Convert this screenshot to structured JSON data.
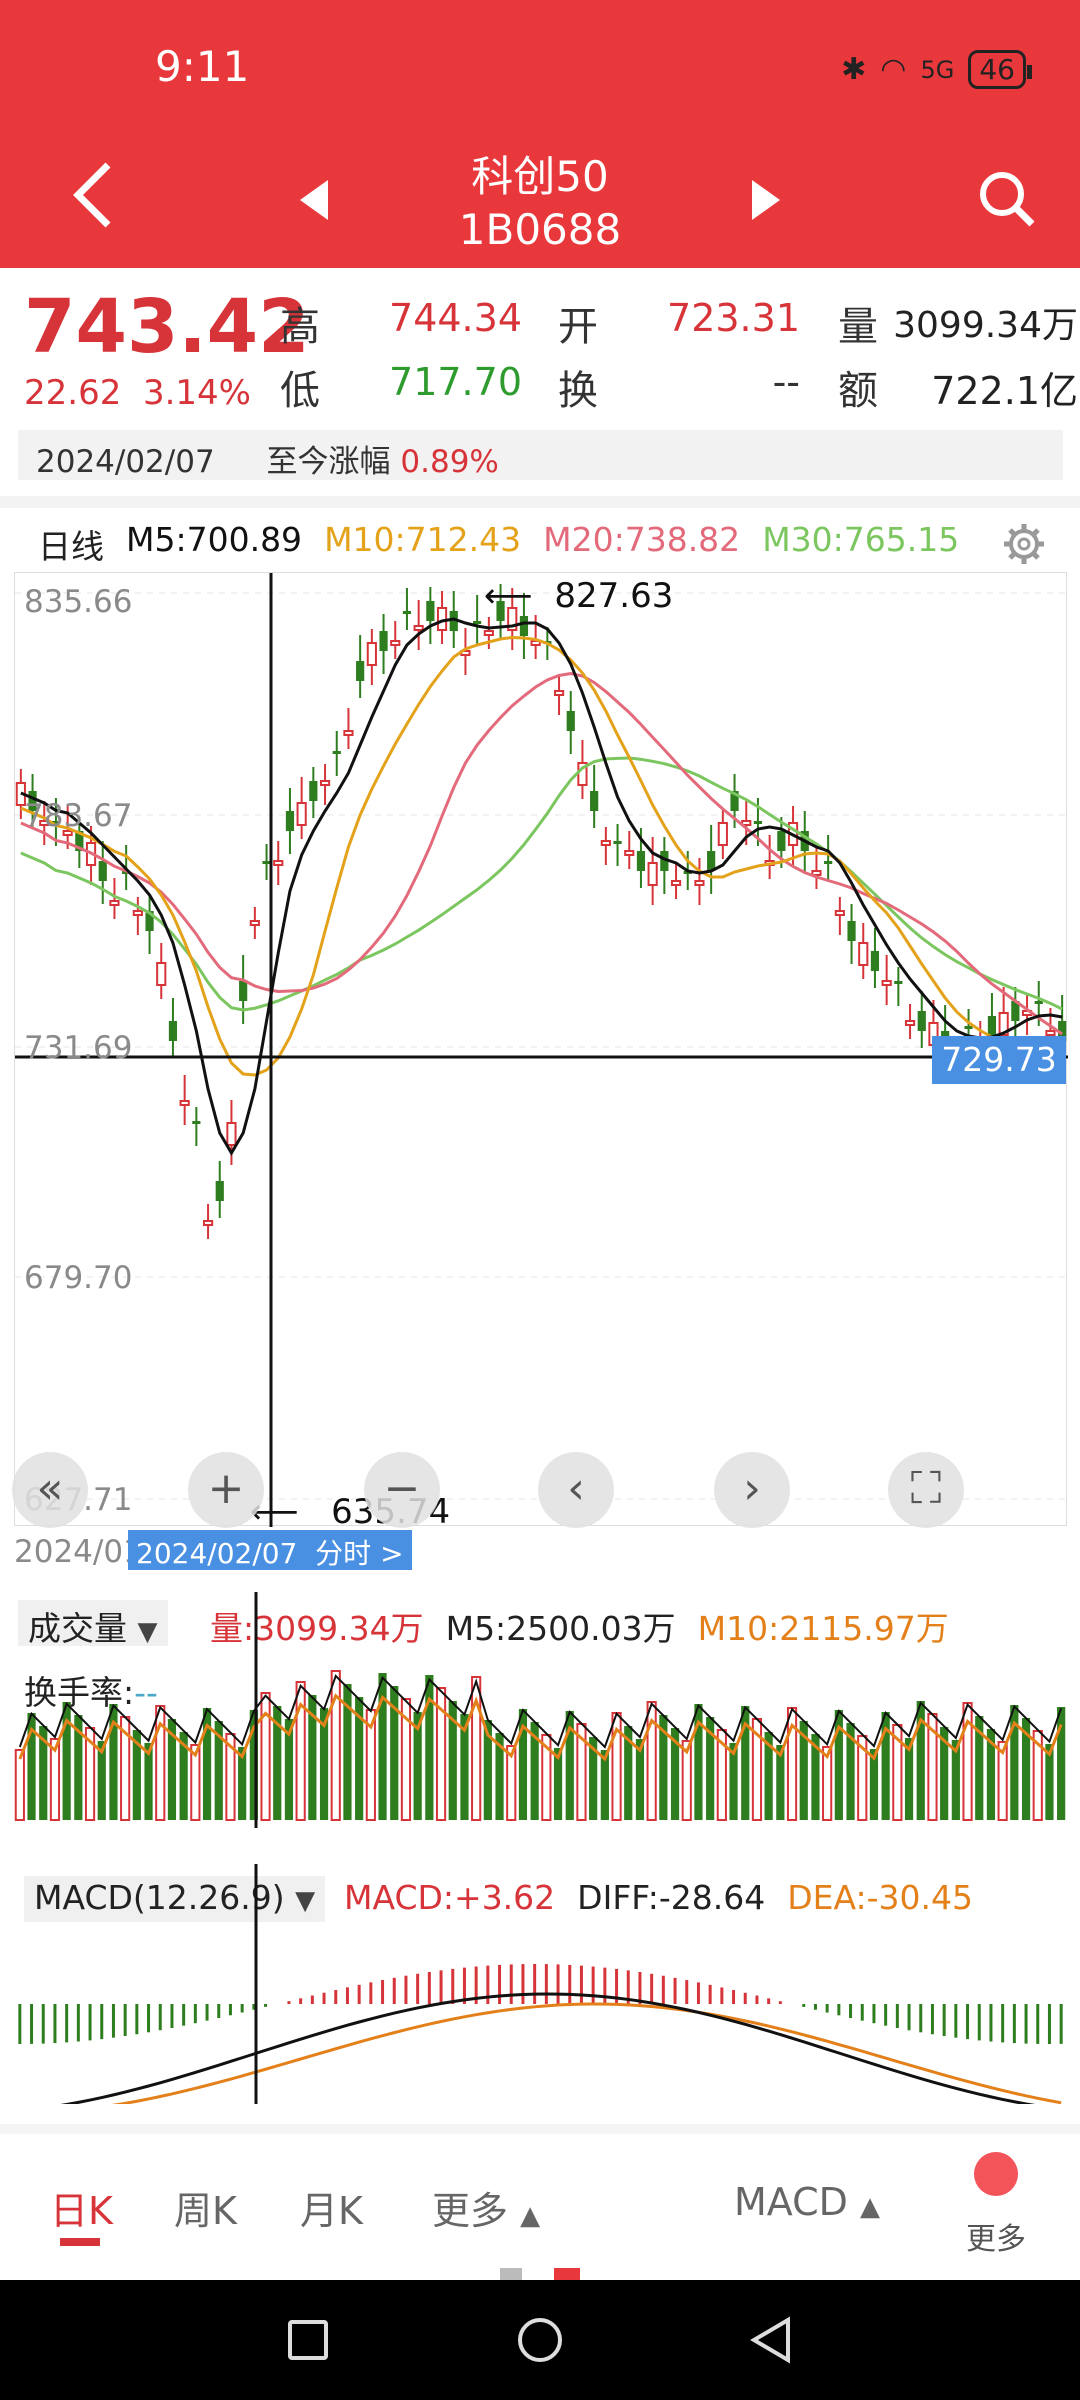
{
  "status_bar": {
    "time": "9:11",
    "battery": "46",
    "signal": "5G"
  },
  "header": {
    "title": "科创50",
    "code": "1B0688"
  },
  "quote": {
    "price": "743.42",
    "change": "22.62",
    "change_pct": "3.14%",
    "high_label": "高",
    "high": "744.34",
    "low_label": "低",
    "low": "717.70",
    "open_label": "开",
    "open": "723.31",
    "turnover_label": "换",
    "turnover": "--",
    "volume_label": "量",
    "volume": "3099.34万",
    "amount_label": "额",
    "amount": "722.1亿",
    "date": "2024/02/07",
    "since_label": "至今涨幅",
    "since_value": "0.89%"
  },
  "ma_line": {
    "period": "日线",
    "m5": "M5:700.89",
    "m10": "M10:712.43",
    "m20": "M20:738.82",
    "m30": "M30:765.15"
  },
  "main_chart": {
    "y_labels": [
      "835.66",
      "783.67",
      "731.69",
      "679.70",
      "627.71"
    ],
    "max_annotation": "827.63",
    "min_annotation": "635.74",
    "crosshair_value": "729.73",
    "date_left": "2024/01",
    "crosshair_date_btn": "2024/02/07  分时 >"
  },
  "volume_panel": {
    "selector": "成交量",
    "vol": "量:3099.34万",
    "m5": "M5:2500.03万",
    "m10": "M10:2115.97万",
    "turnover_rate_label": "换手率:",
    "turnover_rate_value": "--"
  },
  "macd_panel": {
    "selector": "MACD(12.26.9)",
    "macd": "MACD:+3.62",
    "diff": "DIFF:-28.64",
    "dea": "DEA:-30.45"
  },
  "bottom_tabs": {
    "day": "日K",
    "week": "周K",
    "month": "月K",
    "more": "更多",
    "indicator": "MACD",
    "more2": "更多"
  },
  "colors": {
    "header": "#e8383b",
    "up": "#d7343a",
    "down": "#2e7d1e",
    "ma5": "#111111",
    "ma10": "#e3a21a",
    "ma20": "#e36a7a",
    "ma30": "#7cc660",
    "crosshair_tag": "#4a90e2"
  }
}
